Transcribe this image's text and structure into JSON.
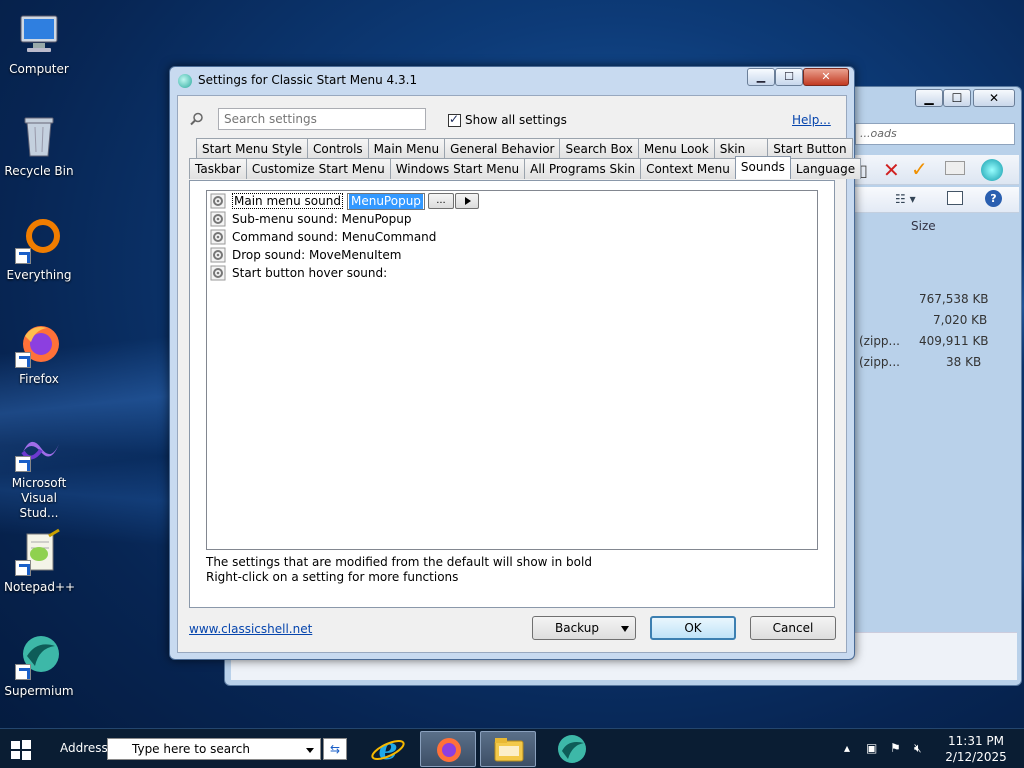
{
  "desktop": {
    "icons": [
      {
        "label": "Computer"
      },
      {
        "label": "Recycle Bin"
      },
      {
        "label": "Everything"
      },
      {
        "label": "Firefox"
      },
      {
        "label": "Microsoft Visual Stud..."
      },
      {
        "label": "Notepad++"
      },
      {
        "label": "Supermium"
      }
    ]
  },
  "background_window": {
    "search_placeholder": "...oads",
    "column_size": "Size",
    "rows": [
      {
        "type": "",
        "size": "767,538 KB"
      },
      {
        "type": "",
        "size": "7,020 KB"
      },
      {
        "type": "(zipp...",
        "size": "409,911 KB"
      },
      {
        "type": "(zipp...",
        "size": "38 KB"
      }
    ]
  },
  "dialog": {
    "title": "Settings for Classic Start Menu 4.3.1",
    "window_buttons": {
      "minimize": "▁",
      "maximize": "☐",
      "close": "✕"
    },
    "search": {
      "placeholder": "Search settings"
    },
    "show_all_label": "Show all settings",
    "help_label": "Help...",
    "tabs_row1": [
      "Start Menu Style",
      "Controls",
      "Main Menu",
      "General Behavior",
      "Search Box",
      "Menu Look",
      "Skin",
      "Start Button"
    ],
    "tabs_row2": [
      "Taskbar",
      "Customize Start Menu",
      "Windows Start Menu",
      "All Programs Skin",
      "Context Menu",
      "Sounds",
      "Language"
    ],
    "active_tab": "Sounds",
    "settings": {
      "main_menu_label": "Main menu sound",
      "main_menu_value": "MenuPopup",
      "browse_label": "...",
      "items": [
        "Sub-menu sound: MenuPopup",
        "Command sound: MenuCommand",
        "Drop sound: MoveMenuItem",
        "Start button hover sound:"
      ]
    },
    "hint_line1": "The settings that are modified from the default will show in bold",
    "hint_line2": "Right-click on a setting for more functions",
    "website": "www.classicshell.net",
    "backup_label": "Backup",
    "ok_label": "OK",
    "cancel_label": "Cancel"
  },
  "taskbar": {
    "address_label": "Address",
    "address_placeholder": "Type here to search",
    "time": "11:31 PM",
    "date": "2/12/2025"
  }
}
